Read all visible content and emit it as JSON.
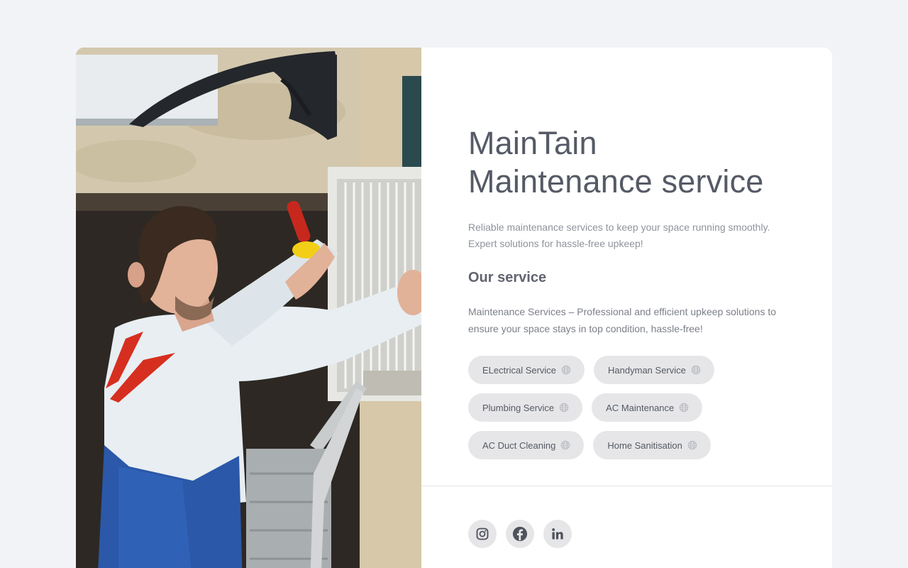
{
  "hero": {
    "title_line1": "MainTain",
    "title_line2": "Maintenance service",
    "tagline_line1": "Reliable maintenance services to keep your space running smoothly.",
    "tagline_line2": "Expert solutions for hassle-free upkeep!"
  },
  "services": {
    "heading": "Our service",
    "description_line1": "Maintenance Services – Professional and efficient upkeep solutions to",
    "description_line2": "ensure your space stays in top condition, hassle-free!",
    "chips": [
      {
        "label": "ELectrical Service",
        "icon": "globe-icon"
      },
      {
        "label": "Handyman Service",
        "icon": "globe-icon"
      },
      {
        "label": "Plumbing Service",
        "icon": "globe-icon"
      },
      {
        "label": "AC Maintenance",
        "icon": "globe-icon"
      },
      {
        "label": "AC Duct Cleaning",
        "icon": "globe-icon"
      },
      {
        "label": "Home Sanitisation",
        "icon": "globe-icon"
      }
    ]
  },
  "social": [
    {
      "name": "instagram",
      "icon": "instagram-icon"
    },
    {
      "name": "facebook",
      "icon": "facebook-icon"
    },
    {
      "name": "linkedin",
      "icon": "linkedin-icon"
    }
  ],
  "colors": {
    "background": "#f2f3f6",
    "card": "#ffffff",
    "chip": "#e6e6e8",
    "title": "#555a66"
  }
}
